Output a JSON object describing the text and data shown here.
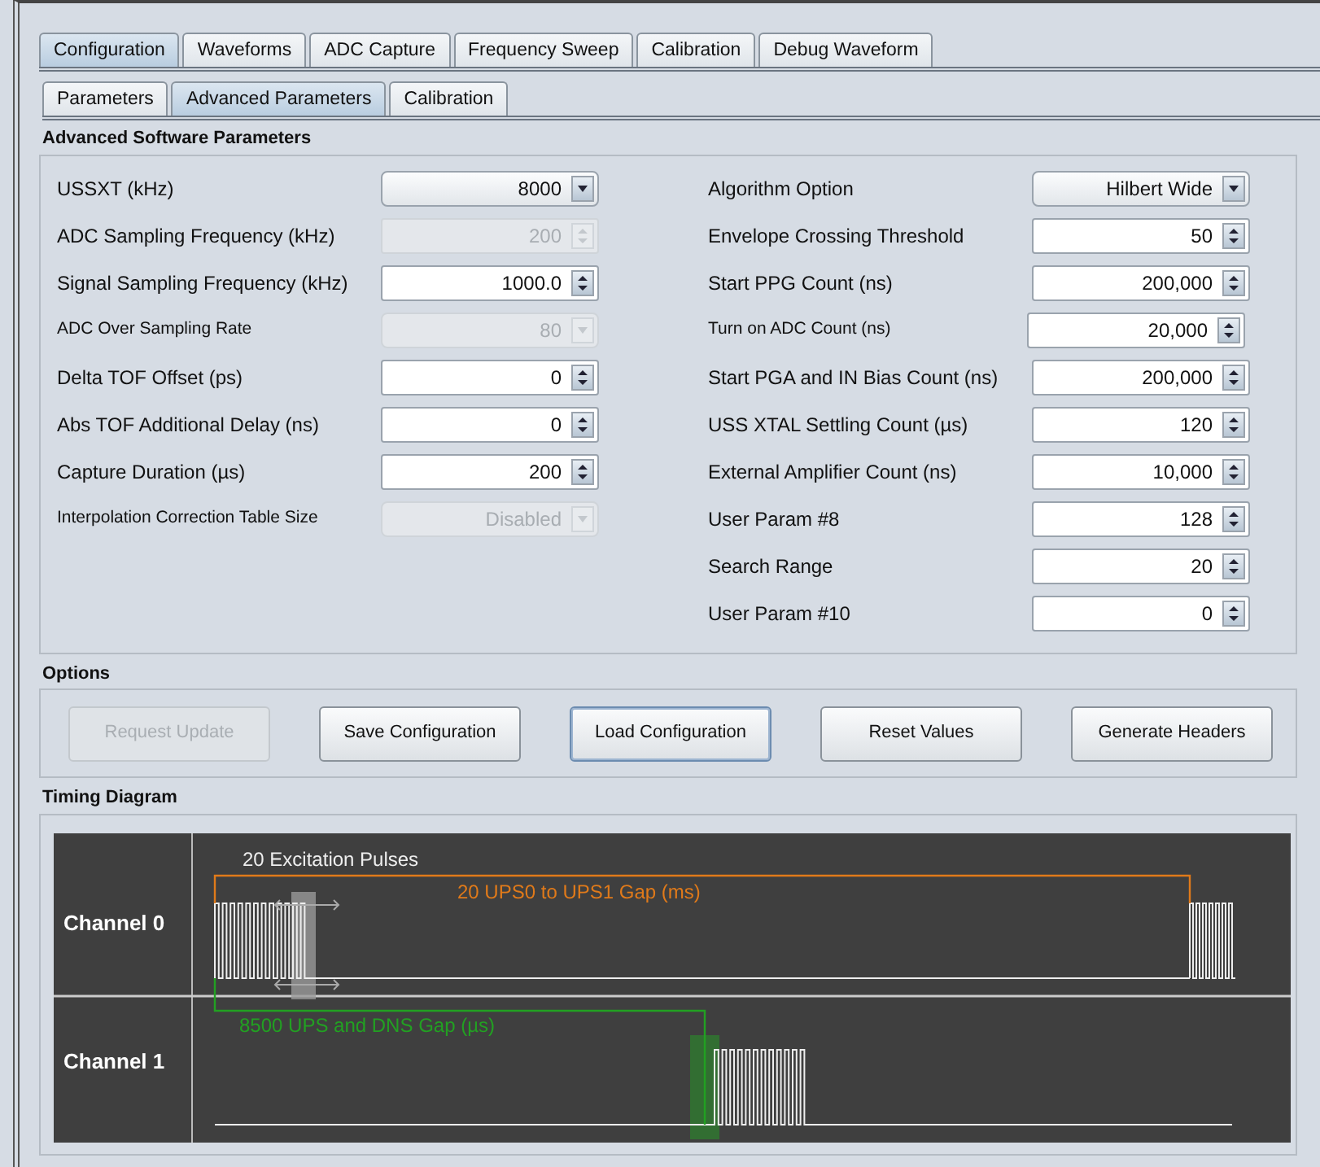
{
  "tabs": [
    {
      "label": "Configuration",
      "selected": true
    },
    {
      "label": "Waveforms",
      "selected": false
    },
    {
      "label": "ADC Capture",
      "selected": false
    },
    {
      "label": "Frequency Sweep",
      "selected": false
    },
    {
      "label": "Calibration",
      "selected": false
    },
    {
      "label": "Debug Waveform",
      "selected": false
    }
  ],
  "subtabs": [
    {
      "label": "Parameters",
      "selected": false
    },
    {
      "label": "Advanced Parameters",
      "selected": true
    },
    {
      "label": "Calibration",
      "selected": false
    }
  ],
  "advanced_software_parameters": {
    "title": "Advanced Software Parameters",
    "left_fields": [
      {
        "label": "USSXT (kHz)",
        "kind": "combo",
        "value": "8000",
        "disabled": false,
        "small": false
      },
      {
        "label": "ADC Sampling Frequency (kHz)",
        "kind": "spinner",
        "value": "200",
        "disabled": true,
        "small": false
      },
      {
        "label": "Signal Sampling Frequency (kHz)",
        "kind": "spinner",
        "value": "1000.0",
        "disabled": false,
        "small": false
      },
      {
        "label": "ADC Over Sampling Rate",
        "kind": "combo",
        "value": "80",
        "disabled": true,
        "small": true
      },
      {
        "label": "Delta TOF Offset (ps)",
        "kind": "spinner",
        "value": "0",
        "disabled": false,
        "small": false
      },
      {
        "label": "Abs TOF Additional Delay (ns)",
        "kind": "spinner",
        "value": "0",
        "disabled": false,
        "small": false
      },
      {
        "label": "Capture Duration (µs)",
        "kind": "spinner",
        "value": "200",
        "disabled": false,
        "small": false
      },
      {
        "label": "Interpolation Correction Table Size",
        "kind": "combo",
        "value": "Disabled",
        "disabled": true,
        "small": true
      }
    ],
    "right_fields": [
      {
        "label": "Algorithm Option",
        "kind": "combo",
        "value": "Hilbert Wide",
        "disabled": false,
        "small": false
      },
      {
        "label": "Envelope Crossing Threshold",
        "kind": "spinner",
        "value": "50",
        "disabled": false,
        "small": false
      },
      {
        "label": "Start PPG Count (ns)",
        "kind": "spinner",
        "value": "200,000",
        "disabled": false,
        "small": false
      },
      {
        "label": "Turn on ADC Count (ns)",
        "kind": "spinner",
        "value": "20,000",
        "disabled": false,
        "small": true
      },
      {
        "label": "Start PGA and IN Bias Count (ns)",
        "kind": "spinner",
        "value": "200,000",
        "disabled": false,
        "small": false
      },
      {
        "label": "USS XTAL Settling Count (µs)",
        "kind": "spinner",
        "value": "120",
        "disabled": false,
        "small": false
      },
      {
        "label": "External Amplifier Count (ns)",
        "kind": "spinner",
        "value": "10,000",
        "disabled": false,
        "small": false
      },
      {
        "label": "User Param #8",
        "kind": "spinner",
        "value": "128",
        "disabled": false,
        "small": false
      },
      {
        "label": "Search Range",
        "kind": "spinner",
        "value": "20",
        "disabled": false,
        "small": false
      },
      {
        "label": "User Param #10",
        "kind": "spinner",
        "value": "0",
        "disabled": false,
        "small": false
      }
    ]
  },
  "options": {
    "title": "Options",
    "buttons": [
      {
        "label": "Request Update",
        "disabled": true,
        "focused": false
      },
      {
        "label": "Save Configuration",
        "disabled": false,
        "focused": false
      },
      {
        "label": "Load Configuration",
        "disabled": false,
        "focused": true
      },
      {
        "label": "Reset Values",
        "disabled": false,
        "focused": false
      },
      {
        "label": "Generate Headers",
        "disabled": false,
        "focused": false
      }
    ]
  },
  "timing_diagram": {
    "title": "Timing Diagram",
    "channels": [
      "Channel 0",
      "Channel 1"
    ],
    "excitation_label": "20 Excitation Pulses",
    "ups_gap_label": "20 UPS0 to UPS1 Gap (ms)",
    "dns_gap_label": "8500 UPS and DNS Gap (µs)"
  }
}
